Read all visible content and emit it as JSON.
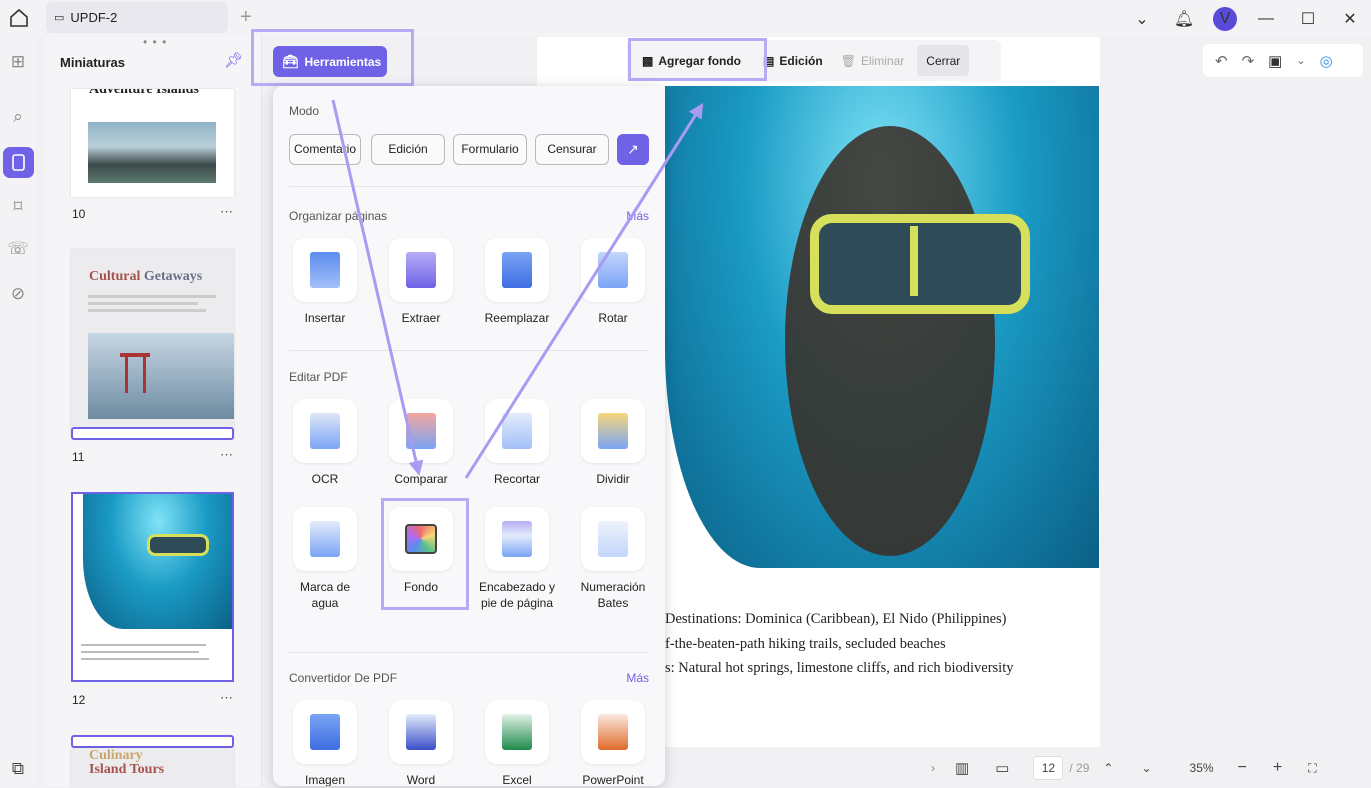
{
  "titlebar": {
    "tab_label": "UPDF-2",
    "avatar_letter": "V"
  },
  "thumbnails": {
    "title": "Miniaturas",
    "pages": [
      {
        "num": "10",
        "heading": "Adventure Islands"
      },
      {
        "num": "11",
        "heading_a": "Cultural",
        "heading_b": "Getaways"
      },
      {
        "num": "12"
      },
      {
        "heading_a": "Culinary",
        "heading_b": "Island Tours"
      }
    ]
  },
  "toolbar": {
    "tools_label": "Herramientas"
  },
  "edit_toolbar": {
    "add_bg": "Agregar fondo",
    "edit": "Edición",
    "delete": "Eliminar",
    "close": "Cerrar"
  },
  "popup": {
    "mode_label": "Modo",
    "modes": [
      "Comentario",
      "Edición",
      "Formulario",
      "Censurar"
    ],
    "organize_label": "Organizar páginas",
    "more": "Más",
    "organize": [
      "Insertar",
      "Extraer",
      "Reemplazar",
      "Rotar"
    ],
    "edit_label": "Editar PDF",
    "edit": [
      "OCR",
      "Comparar",
      "Recortar",
      "Dividir",
      "Marca de agua",
      "Fondo",
      "Encabezado y pie de página",
      "Numeración Bates"
    ],
    "convert_label": "Convertidor De PDF",
    "convert": [
      "Imagen",
      "Word",
      "Excel",
      "PowerPoint"
    ]
  },
  "document": {
    "lines": [
      "Destinations: Dominica (Caribbean), El Nido (Philippines)",
      "f-the-beaten-path hiking trails, secluded beaches",
      "s: Natural hot springs, limestone cliffs, and rich biodiversity"
    ]
  },
  "bottombar": {
    "page": "12",
    "total": "/ 29",
    "zoom": "35%"
  },
  "colors": {
    "accent": "#6f62e6",
    "highlight": "#b6acf5"
  }
}
